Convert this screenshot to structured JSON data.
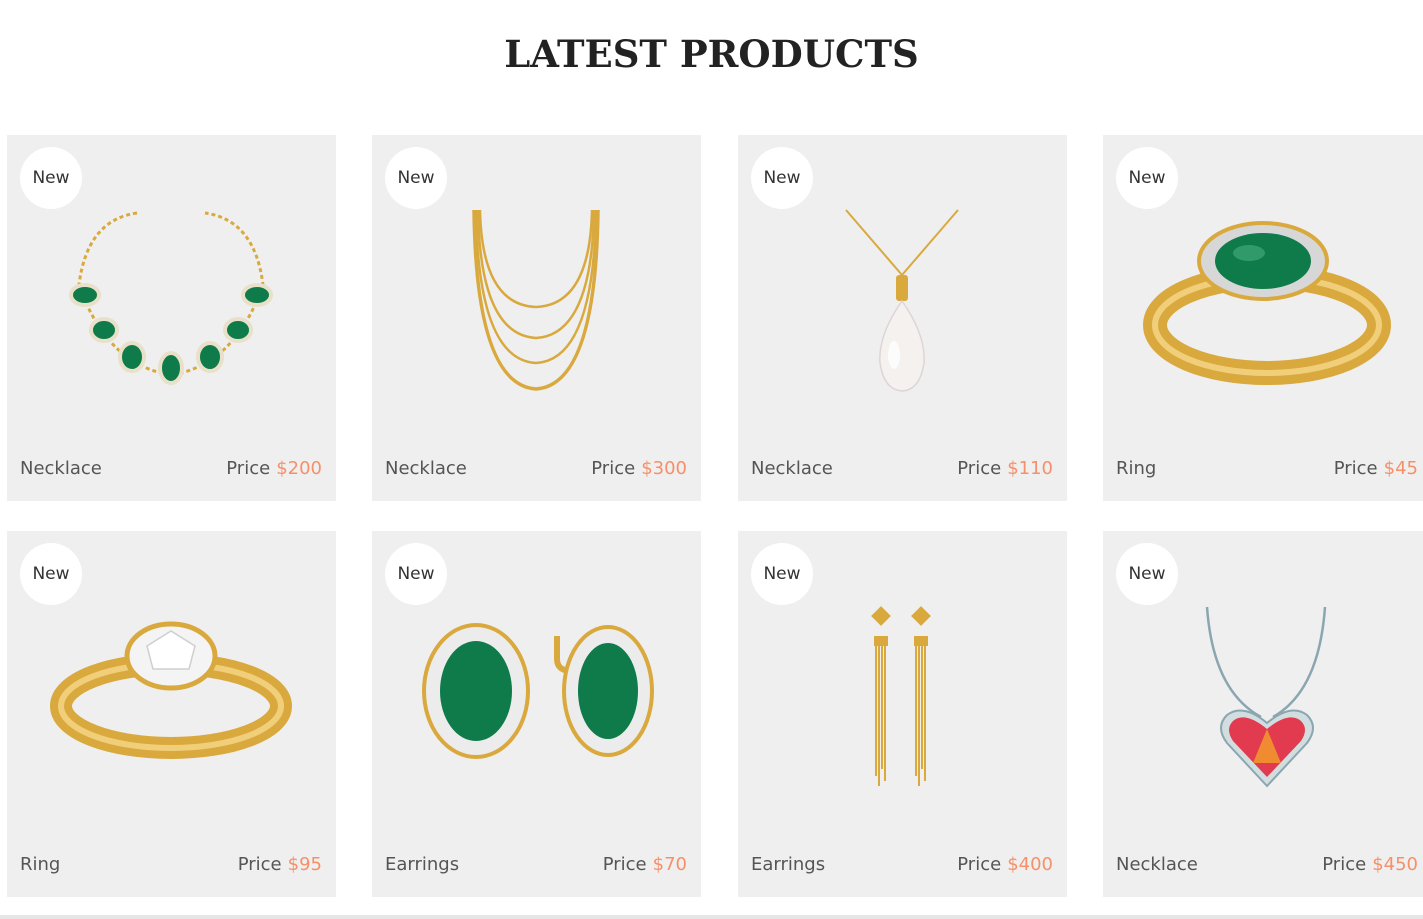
{
  "section": {
    "title": "LATEST PRODUCTS"
  },
  "products": [
    {
      "badge": "New",
      "name": "Necklace",
      "price_label": "Price",
      "price": "$200",
      "icon": "emerald-necklace-icon"
    },
    {
      "badge": "New",
      "name": "Necklace",
      "price_label": "Price",
      "price": "$300",
      "icon": "gold-chain-icon"
    },
    {
      "badge": "New",
      "name": "Necklace",
      "price_label": "Price",
      "price": "$110",
      "icon": "pearl-pendant-icon"
    },
    {
      "badge": "New",
      "name": "Ring",
      "price_label": "Price",
      "price": "$45",
      "icon": "emerald-ring-icon"
    },
    {
      "badge": "New",
      "name": "Ring",
      "price_label": "Price",
      "price": "$95",
      "icon": "diamond-ring-icon"
    },
    {
      "badge": "New",
      "name": "Earrings",
      "price_label": "Price",
      "price": "$70",
      "icon": "emerald-earrings-icon"
    },
    {
      "badge": "New",
      "name": "Earrings",
      "price_label": "Price",
      "price": "$400",
      "icon": "tassel-earrings-icon"
    },
    {
      "badge": "New",
      "name": "Necklace",
      "price_label": "Price",
      "price": "$450",
      "icon": "heart-pendant-icon"
    }
  ],
  "colors": {
    "accent": "#f5906a",
    "card_bg": "#efefef",
    "text": "#555555",
    "gold": "#d9a93e",
    "emerald": "#0f7a4a"
  }
}
